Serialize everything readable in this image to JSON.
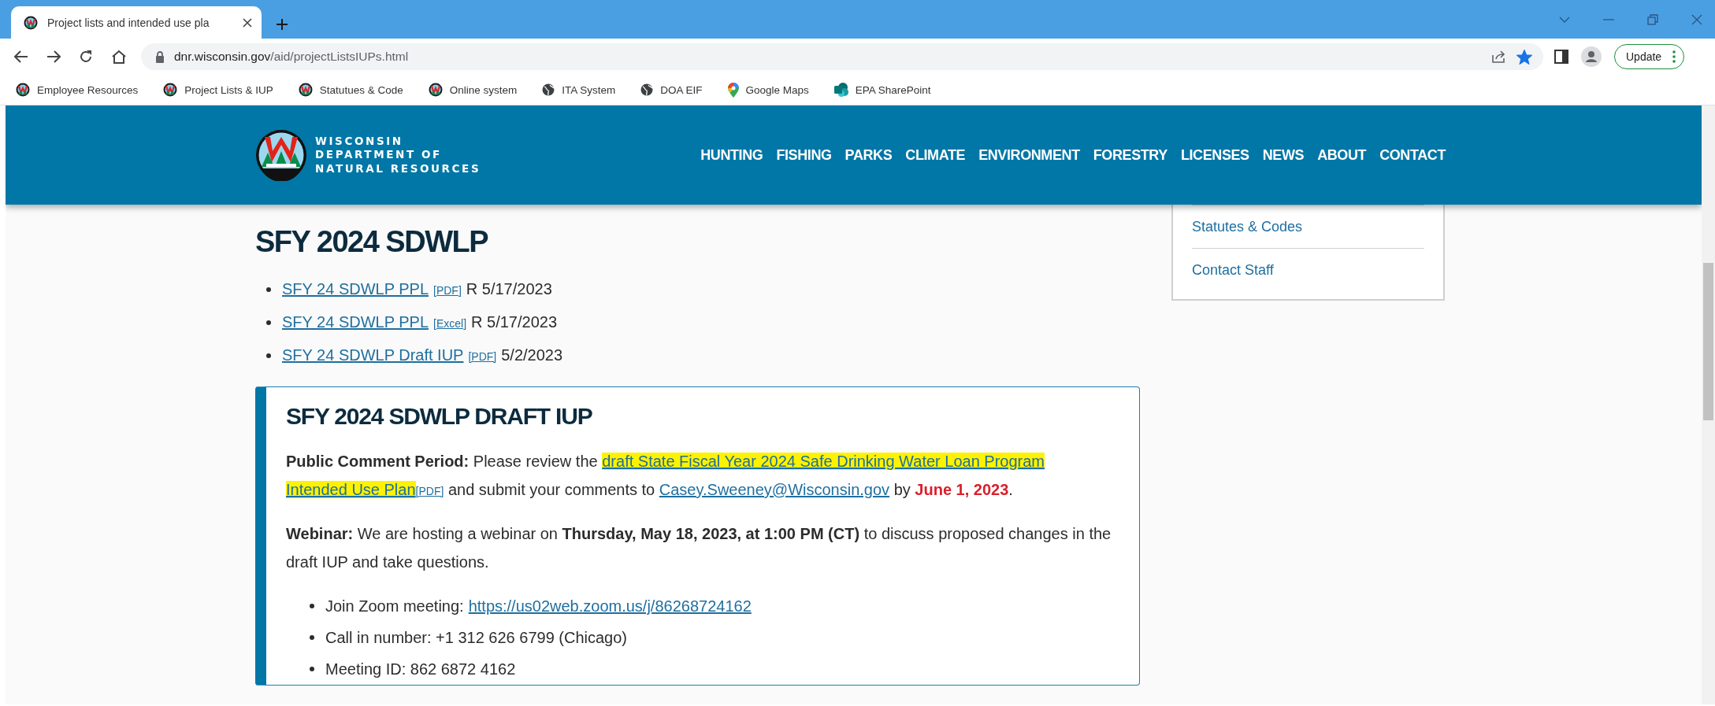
{
  "browser": {
    "tab": {
      "title": "Project lists and intended use pla",
      "selected": true
    },
    "address": {
      "host": "dnr.wisconsin.gov",
      "path": "/aid/projectListsIUPs.html"
    },
    "bookmarked": true,
    "update_button": "Update",
    "bookmarks": [
      {
        "label": "Employee Resources",
        "kind": "dnr"
      },
      {
        "label": "Project Lists & IUP",
        "kind": "dnr"
      },
      {
        "label": "Statutues & Code",
        "kind": "dnr"
      },
      {
        "label": "Online system",
        "kind": "dnr"
      },
      {
        "label": "ITA System",
        "kind": "globe"
      },
      {
        "label": "DOA EIF",
        "kind": "globe"
      },
      {
        "label": "Google Maps",
        "kind": "maps"
      },
      {
        "label": "EPA SharePoint",
        "kind": "sharepoint"
      }
    ]
  },
  "site": {
    "logo_lines": [
      "WISCONSIN",
      "DEPARTMENT OF",
      "NATURAL RESOURCES"
    ],
    "nav": [
      "HUNTING",
      "FISHING",
      "PARKS",
      "CLIMATE",
      "ENVIRONMENT",
      "FORESTRY",
      "LICENSES",
      "NEWS",
      "ABOUT",
      "CONTACT"
    ]
  },
  "sidebar": {
    "items": [
      "Statutes & Codes",
      "Contact Staff"
    ]
  },
  "main": {
    "heading": "SFY 2024 SDWLP",
    "documents": [
      {
        "title": "SFY 24 SDWLP PPL",
        "format": "[PDF]",
        "date": "R 5/17/2023"
      },
      {
        "title": "SFY 24 SDWLP PPL",
        "format": "[Excel]",
        "date": "R 5/17/2023"
      },
      {
        "title": "SFY 24 SDWLP Draft IUP",
        "format": "[PDF]",
        "date": "5/2/2023"
      }
    ],
    "notice": {
      "heading": "SFY 2024 SDWLP DRAFT IUP",
      "comment": [
        {
          "kind": "bold",
          "text": "Public Comment Period:"
        },
        {
          "kind": "text",
          "text": " Please review the "
        },
        {
          "kind": "link",
          "text": "draft State Fiscal Year 2024 Safe Drinking Water Loan Program",
          "highlighted": true
        },
        {
          "kind": "link",
          "text": "Intended Use Plan",
          "highlighted": true
        },
        {
          "kind": "tag",
          "text": "[PDF]"
        },
        {
          "kind": "text",
          "text": " and submit your comments to "
        },
        {
          "kind": "email",
          "text": "Casey.Sweeney@Wisconsin.gov"
        },
        {
          "kind": "text",
          "text": " by "
        },
        {
          "kind": "alert",
          "text": "June 1, 2023"
        },
        {
          "kind": "text",
          "text": "."
        }
      ],
      "webinar": "**Webinar:** We are hosting a webinar on **Thursday, May 18, 2023, at 1:00 PM (CT)** to discuss proposed changes in the draft IUP and take questions.",
      "details": [
        {
          "label": "Join Zoom meeting:",
          "link": "https://us02web.zoom.us/j/86268724162"
        },
        {
          "label": "Call in number: +1 312 626 6799 (Chicago)"
        },
        {
          "label": "Meeting ID: 862 6872 4162"
        }
      ]
    }
  }
}
